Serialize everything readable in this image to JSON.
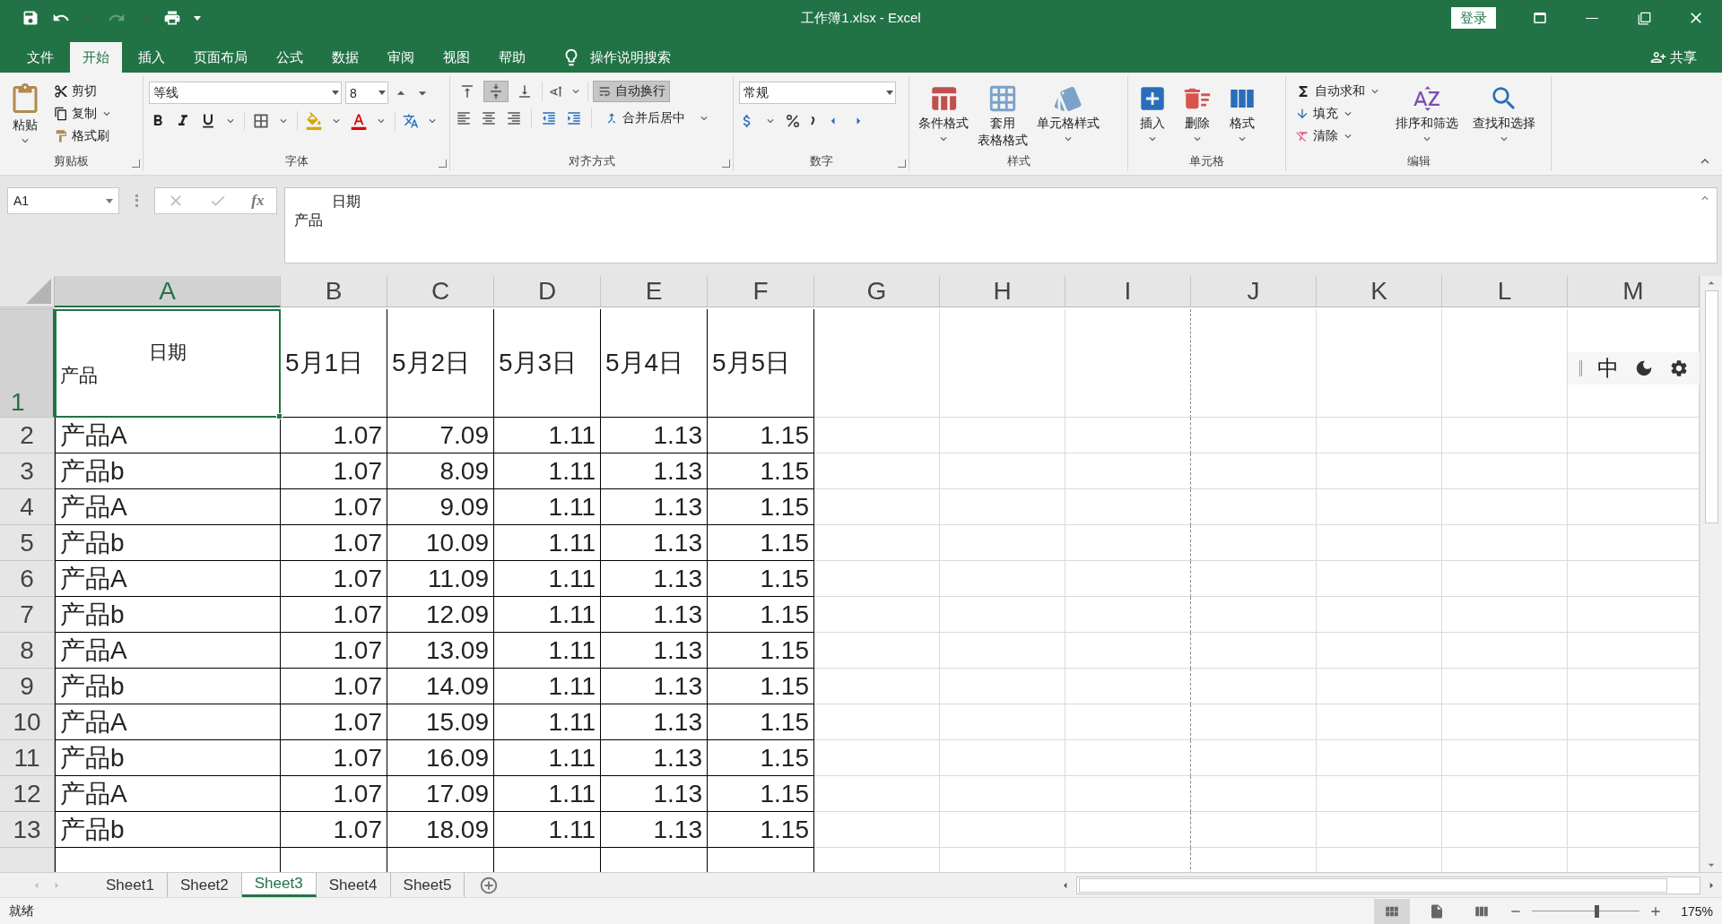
{
  "title_bar": {
    "title": "工作簿1.xlsx  -  Excel",
    "login": "登录"
  },
  "ribbon_tabs": [
    {
      "label": "文件",
      "selected": false
    },
    {
      "label": "开始",
      "selected": true
    },
    {
      "label": "插入",
      "selected": false
    },
    {
      "label": "页面布局",
      "selected": false
    },
    {
      "label": "公式",
      "selected": false
    },
    {
      "label": "数据",
      "selected": false
    },
    {
      "label": "审阅",
      "selected": false
    },
    {
      "label": "视图",
      "selected": false
    },
    {
      "label": "帮助",
      "selected": false
    }
  ],
  "tell_me": "操作说明搜索",
  "share": "共享",
  "ribbon": {
    "clipboard": {
      "label": "剪贴板",
      "paste": "粘贴",
      "cut": "剪切",
      "copy": "复制",
      "format_painter": "格式刷"
    },
    "font": {
      "label": "字体",
      "font_name": "等线",
      "font_size": "8"
    },
    "alignment": {
      "label": "对齐方式",
      "vertical_align": [
        {
          "selected": false
        },
        {
          "selected": true
        },
        {
          "selected": false
        }
      ],
      "wrap_text": {
        "label": "自动换行",
        "selected": true
      },
      "merge_center": "合并后居中"
    },
    "number": {
      "label": "数字",
      "format": "常规"
    },
    "styles": {
      "label": "样式",
      "conditional": "条件格式",
      "table_format": [
        "套用",
        "表格格式"
      ],
      "cell_styles": "单元格样式"
    },
    "cells": {
      "label": "单元格",
      "insert": "插入",
      "delete": "删除",
      "format": "格式"
    },
    "editing": {
      "label": "编辑",
      "autosum": "自动求和",
      "fill": "填充",
      "clear": "清除",
      "sort_filter": "排序和筛选",
      "find_select": "查找和选择"
    }
  },
  "formula_bar": {
    "name_box": "A1",
    "fx": "fx",
    "lines": [
      "日期",
      "产品"
    ]
  },
  "sheet": {
    "columns": [
      {
        "label": "A",
        "selected": true
      },
      {
        "label": "B",
        "selected": false
      },
      {
        "label": "C",
        "selected": false
      },
      {
        "label": "D",
        "selected": false
      },
      {
        "label": "E",
        "selected": false
      },
      {
        "label": "F",
        "selected": false
      },
      {
        "label": "G",
        "selected": false
      },
      {
        "label": "H",
        "selected": false
      },
      {
        "label": "I",
        "selected": false
      },
      {
        "label": "J",
        "selected": false
      },
      {
        "label": "K",
        "selected": false
      },
      {
        "label": "L",
        "selected": false
      },
      {
        "label": "M",
        "selected": false
      }
    ],
    "header_row": {
      "number": "1",
      "selected": true,
      "a1_lines": [
        "日期",
        "产品"
      ],
      "dates": [
        "5月1日",
        "5月2日",
        "5月3日",
        "5月4日",
        "5月5日"
      ]
    },
    "rows": [
      {
        "number": "2",
        "selected": false,
        "cells": [
          "产品A",
          "1.07",
          "7.09",
          "1.11",
          "1.13",
          "1.15"
        ]
      },
      {
        "number": "3",
        "selected": false,
        "cells": [
          "产品b",
          "1.07",
          "8.09",
          "1.11",
          "1.13",
          "1.15"
        ]
      },
      {
        "number": "4",
        "selected": false,
        "cells": [
          "产品A",
          "1.07",
          "9.09",
          "1.11",
          "1.13",
          "1.15"
        ]
      },
      {
        "number": "5",
        "selected": false,
        "cells": [
          "产品b",
          "1.07",
          "10.09",
          "1.11",
          "1.13",
          "1.15"
        ]
      },
      {
        "number": "6",
        "selected": false,
        "cells": [
          "产品A",
          "1.07",
          "11.09",
          "1.11",
          "1.13",
          "1.15"
        ]
      },
      {
        "number": "7",
        "selected": false,
        "cells": [
          "产品b",
          "1.07",
          "12.09",
          "1.11",
          "1.13",
          "1.15"
        ]
      },
      {
        "number": "8",
        "selected": false,
        "cells": [
          "产品A",
          "1.07",
          "13.09",
          "1.11",
          "1.13",
          "1.15"
        ]
      },
      {
        "number": "9",
        "selected": false,
        "cells": [
          "产品b",
          "1.07",
          "14.09",
          "1.11",
          "1.13",
          "1.15"
        ]
      },
      {
        "number": "10",
        "selected": false,
        "cells": [
          "产品A",
          "1.07",
          "15.09",
          "1.11",
          "1.13",
          "1.15"
        ]
      },
      {
        "number": "11",
        "selected": false,
        "cells": [
          "产品b",
          "1.07",
          "16.09",
          "1.11",
          "1.13",
          "1.15"
        ]
      },
      {
        "number": "12",
        "selected": false,
        "cells": [
          "产品A",
          "1.07",
          "17.09",
          "1.11",
          "1.13",
          "1.15"
        ]
      },
      {
        "number": "13",
        "selected": false,
        "cells": [
          "产品b",
          "1.07",
          "18.09",
          "1.11",
          "1.13",
          "1.15"
        ]
      }
    ]
  },
  "ime_bar": {
    "mode": "中"
  },
  "sheet_tabs": [
    {
      "label": "Sheet1",
      "selected": false
    },
    {
      "label": "Sheet2",
      "selected": false
    },
    {
      "label": "Sheet3",
      "selected": true
    },
    {
      "label": "Sheet4",
      "selected": false
    },
    {
      "label": "Sheet5",
      "selected": false
    }
  ],
  "status_bar": {
    "status": "就绪",
    "zoom_slider": {
      "level": 0.6
    },
    "zoom": "175%"
  }
}
